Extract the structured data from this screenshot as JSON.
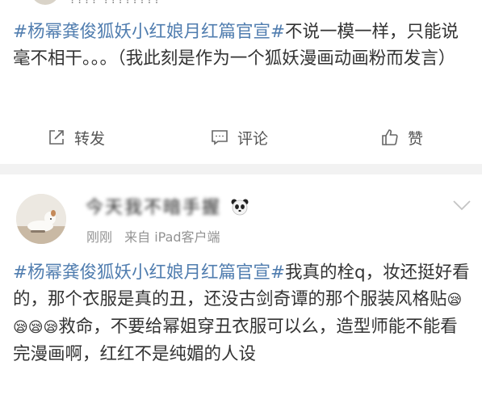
{
  "top_partial": {
    "author_cut": "???? ????????"
  },
  "post1": {
    "topic": "#杨幂龚俊狐妖小红娘月红篇官宣#",
    "text": "不说一模一样，只能说毫不相干。。。（我此刻是作为一个狐妖漫画动画粉而发言）"
  },
  "actions": {
    "repost": "转发",
    "comment": "评论",
    "like": "赞"
  },
  "post2": {
    "author_name": "今天我不暗手握",
    "time": "刚刚",
    "source": "来自 iPad客户端",
    "topic": "#杨幂龚俊狐妖小红娘月红篇官宣#",
    "text_before_emoji": "我真的栓q，妆还挺好看的，那个衣服是真的丑，还没古剑奇谭的那个服装风格贴",
    "emojis": "😪😪😪😪",
    "text_after_emoji": "救命，不要给幂姐穿丑衣服可以么，造型师能不能看完漫画啊，红红不是纯媚的人设"
  },
  "icons": {
    "repost": "share-box-icon",
    "comment": "comment-bubble-icon",
    "like": "thumbs-up-icon",
    "chevron": "chevron-down-icon",
    "badge": "panda-icon"
  },
  "colors": {
    "topic": "#507daf",
    "text": "#333333",
    "meta": "#939393",
    "separator": "#f2f2f2"
  }
}
